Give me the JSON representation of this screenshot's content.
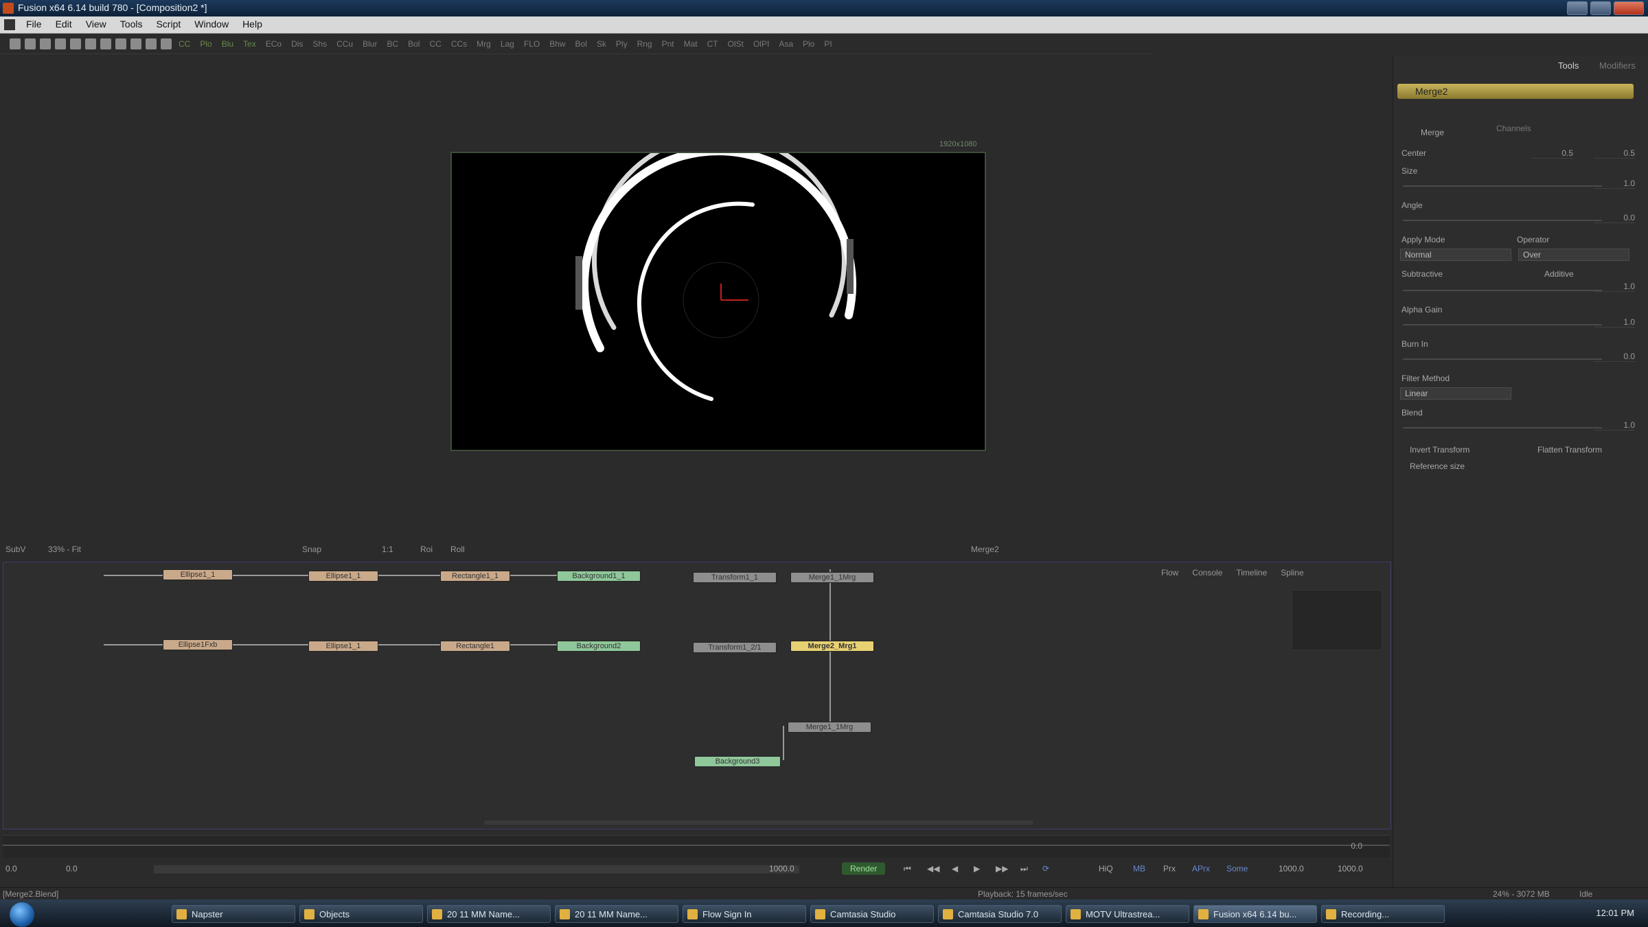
{
  "window": {
    "title": "Fusion x64 6.14 build 780 - [Composition2 *]"
  },
  "menu": [
    "File",
    "Edit",
    "View",
    "Tools",
    "Script",
    "Window",
    "Help"
  ],
  "toolbar": {
    "tools": [
      "CC",
      "Plo",
      "Blu",
      "Tex",
      "ECo",
      "Dis",
      "Shs",
      "CCu",
      "Blur",
      "BC",
      "Bol",
      "CC",
      "CCs",
      "Mrg",
      "Lag",
      "FLO",
      "Bhw",
      "Bol",
      "Sk",
      "Ply",
      "Rng",
      "Pnt",
      "Mat",
      "CT",
      "OlSt",
      "OlPI",
      "Asa",
      "Plo",
      "PI"
    ]
  },
  "viewer": {
    "resolution_label": "1920x1080"
  },
  "inspector": {
    "tabs": [
      "Tools",
      "Modifiers"
    ],
    "tool_name": "Merge2",
    "subtabs": [
      "Merge",
      "Channels"
    ],
    "params": {
      "center_label": "Center",
      "center_x": "0.5",
      "center_y": "0.5",
      "size_label": "Size",
      "size_value": "1.0",
      "angle_label": "Angle",
      "angle_value": "0.0",
      "apply_mode_label": "Apply Mode",
      "apply_mode_value": "Normal",
      "operator_label": "Operator",
      "operator_value": "Over",
      "subtractive_label": "Subtractive",
      "additive_label": "Additive",
      "sub_add_value": "1.0",
      "alpha_gain_label": "Alpha Gain",
      "alpha_gain_value": "1.0",
      "burn_in_label": "Burn In",
      "burn_in_value": "0.0",
      "filter_method_label": "Filter Method",
      "filter_method_value": "Linear",
      "blend_label": "Blend",
      "blend_value": "1.0",
      "invert_transform": "Invert Transform",
      "flatten_transform": "Flatten Transform",
      "reference_size": "Reference size"
    }
  },
  "flow": {
    "header_title": "Merge2",
    "toolbar_left": [
      "SubV",
      "33% - Fit",
      "Snap",
      "1:1",
      "Roi",
      "Roll"
    ],
    "tools_right": [
      "Flow",
      "Console",
      "Timeline",
      "Spline"
    ],
    "nodes_row1": [
      "Ellipse1_1",
      "Ellipse1_1",
      "Rectangle1_1",
      "Background1_1",
      "Transform1_1",
      "Merge1_1Mrg"
    ],
    "nodes_row2": [
      "Ellipse1Fxb",
      "Ellipse1_1",
      "Rectangle1",
      "Background2",
      "Transform1_2/1",
      "Merge2_Mrg1"
    ],
    "nodes_row3": [
      "Merge1_1Mrg",
      "Background3"
    ]
  },
  "timeline": {
    "start": "0.0",
    "current": "0.0",
    "render_end": "1000.0",
    "end": "1000.0",
    "render_button": "Render",
    "hq": "HiQ",
    "mb": "MB",
    "prx": "Prx",
    "aprx": "APrx",
    "some": "Some",
    "current_frame": "0.0"
  },
  "status": {
    "left": "[Merge2.Blend]",
    "center": "Playback: 15 frames/sec",
    "right": "24% - 3072 MB",
    "idle": "Idle"
  },
  "taskbar": {
    "items": [
      "Napster",
      "Objects",
      "20 11 MM Name...",
      "20 11 MM Name...",
      "Flow Sign In",
      "Camtasia Studio",
      "Camtasia Studio 7.0",
      "MOTV Ultrastrea...",
      "Fusion x64 6.14 bu...",
      "Recording..."
    ],
    "clock": "12:01 PM"
  },
  "colors": {
    "accent_yellow": "#e7d173",
    "node_tan": "#c9a98a",
    "node_green": "#8fc79a",
    "bg": "#2b2b2b"
  }
}
